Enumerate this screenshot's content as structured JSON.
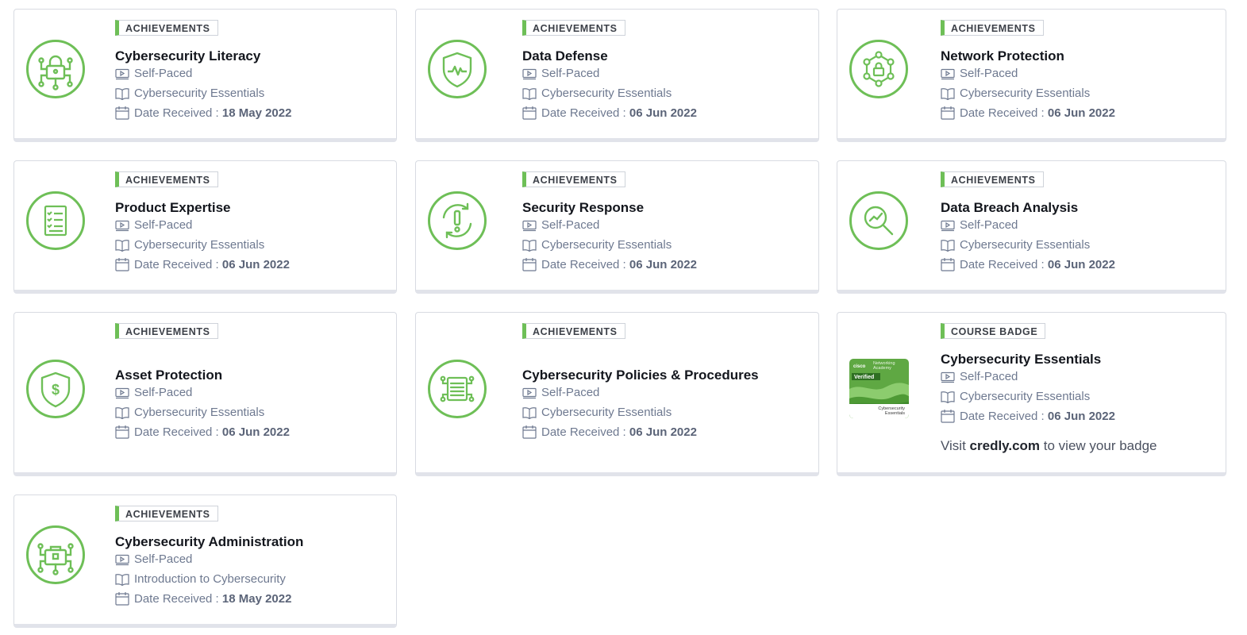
{
  "labels": {
    "date_received": "Date Received : ",
    "visit_prefix": "Visit ",
    "visit_site": "credly.com",
    "visit_suffix": " to view your badge"
  },
  "cards": [
    {
      "tag": "ACHIEVEMENTS",
      "title": "Cybersecurity Literacy",
      "mode": "Self-Paced",
      "course": "Cybersecurity Essentials",
      "date": "18 May 2022",
      "icon": "lock-network-icon"
    },
    {
      "tag": "ACHIEVEMENTS",
      "title": "Data Defense",
      "mode": "Self-Paced",
      "course": "Cybersecurity Essentials",
      "date": "06 Jun 2022",
      "icon": "shield-pulse-icon"
    },
    {
      "tag": "ACHIEVEMENTS",
      "title": "Network Protection",
      "mode": "Self-Paced",
      "course": "Cybersecurity Essentials",
      "date": "06 Jun 2022",
      "icon": "network-lock-icon"
    },
    {
      "tag": "ACHIEVEMENTS",
      "title": "Product Expertise",
      "mode": "Self-Paced",
      "course": "Cybersecurity Essentials",
      "date": "06 Jun 2022",
      "icon": "checklist-icon"
    },
    {
      "tag": "ACHIEVEMENTS",
      "title": "Security Response",
      "mode": "Self-Paced",
      "course": "Cybersecurity Essentials",
      "date": "06 Jun 2022",
      "icon": "alert-cycle-icon"
    },
    {
      "tag": "ACHIEVEMENTS",
      "title": "Data Breach Analysis",
      "mode": "Self-Paced",
      "course": "Cybersecurity Essentials",
      "date": "06 Jun 2022",
      "icon": "magnifier-chart-icon"
    },
    {
      "tag": "ACHIEVEMENTS",
      "title": "Asset Protection",
      "mode": "Self-Paced",
      "course": "Cybersecurity Essentials",
      "date": "06 Jun 2022",
      "icon": "shield-dollar-icon"
    },
    {
      "tag": "ACHIEVEMENTS",
      "title": "Cybersecurity Policies & Procedures",
      "mode": "Self-Paced",
      "course": "Cybersecurity Essentials",
      "date": "06 Jun 2022",
      "icon": "document-circuit-icon"
    },
    {
      "tag": "COURSE BADGE",
      "title": "Cybersecurity Essentials",
      "mode": "Self-Paced",
      "course": "Cybersecurity Essentials",
      "date": "06 Jun 2022",
      "icon": "course-badge-image",
      "badge_image": {
        "org_small": "Networking",
        "org_small2": "Academy",
        "brand": "cisco",
        "verified": "Verified",
        "course_line1": "Cybersecurity",
        "course_line2": "Essentials"
      }
    },
    {
      "tag": "ACHIEVEMENTS",
      "title": "Cybersecurity Administration",
      "mode": "Self-Paced",
      "course": "Introduction to Cybersecurity",
      "date": "18 May 2022",
      "icon": "briefcase-network-icon"
    }
  ]
}
